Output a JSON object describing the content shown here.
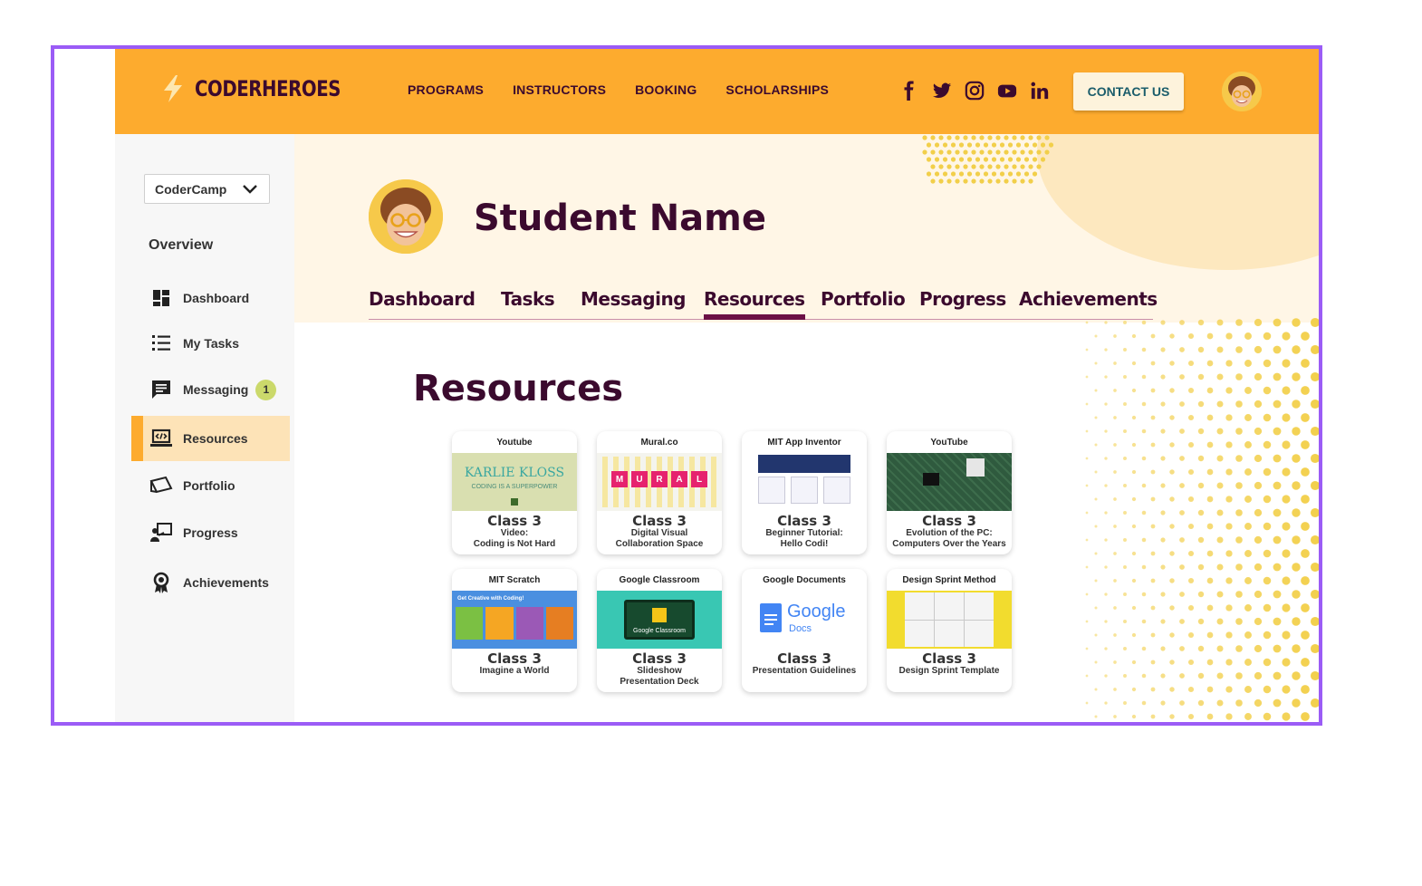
{
  "brand": {
    "name": "CODERHEROES"
  },
  "nav": {
    "items": [
      "PROGRAMS",
      "INSTRUCTORS",
      "BOOKING",
      "SCHOLARSHIPS"
    ],
    "contact_label": "CONTACT US",
    "social_icons": [
      "facebook-icon",
      "twitter-icon",
      "instagram-icon",
      "youtube-icon",
      "linkedin-icon"
    ]
  },
  "sidebar": {
    "program_select": "CoderCamp",
    "section_title": "Overview",
    "items": [
      {
        "label": "Dashboard",
        "icon": "dashboard-icon"
      },
      {
        "label": "My Tasks",
        "icon": "list-icon"
      },
      {
        "label": "Messaging",
        "icon": "message-icon",
        "badge": "1"
      },
      {
        "label": "Resources",
        "icon": "laptop-code-icon",
        "active": true
      },
      {
        "label": "Portfolio",
        "icon": "portfolio-icon"
      },
      {
        "label": "Progress",
        "icon": "presentation-icon"
      },
      {
        "label": "Achievements",
        "icon": "award-icon"
      }
    ]
  },
  "profile": {
    "name": "Student Name"
  },
  "tabs": [
    "Dashboard",
    "Tasks",
    "Messaging",
    "Resources",
    "Portfolio",
    "Progress",
    "Achievements"
  ],
  "active_tab": "Resources",
  "resources": {
    "title": "Resources",
    "cards": [
      {
        "source": "Youtube",
        "class": "Class 3",
        "desc": [
          "Video:",
          "Coding is Not Hard"
        ],
        "thumb_text": [
          "KARLIE KLOSS",
          "CODING IS A SUPERPOWER"
        ]
      },
      {
        "source": "Mural.co",
        "class": "Class 3",
        "desc": [
          "Digital Visual",
          "Collaboration Space"
        ],
        "thumb_text": [
          "M",
          "U",
          "R",
          "A",
          "L"
        ]
      },
      {
        "source": "MIT App Inventor",
        "class": "Class 3",
        "desc": [
          "Beginner Tutorial:",
          "Hello Codi!"
        ]
      },
      {
        "source": "YouTube",
        "class": "Class 3",
        "desc": [
          "Evolution of the PC:",
          "Computers Over the Years"
        ]
      },
      {
        "source": "MIT Scratch",
        "class": "Class 3",
        "desc": [
          "Imagine a World"
        ],
        "thumb_text": [
          "Get Creative with Coding!"
        ]
      },
      {
        "source": "Google Classroom",
        "class": "Class 3",
        "desc": [
          "Slideshow",
          "Presentation Deck"
        ],
        "thumb_text": [
          "Google Classroom"
        ]
      },
      {
        "source": "Google Documents",
        "class": "Class 3",
        "desc": [
          "Presentation Guidelines"
        ],
        "thumb_text": [
          "Google",
          "Docs"
        ]
      },
      {
        "source": "Design Sprint Method",
        "class": "Class 3",
        "desc": [
          "Design Sprint Template"
        ]
      }
    ]
  },
  "colors": {
    "header": "#fdab2e",
    "brand_dark": "#3b0a2e",
    "accent_tab": "#6b1046",
    "frame": "#9b5cf6",
    "hero_bg": "#fff6e6",
    "dots": "#f2cf4a"
  }
}
